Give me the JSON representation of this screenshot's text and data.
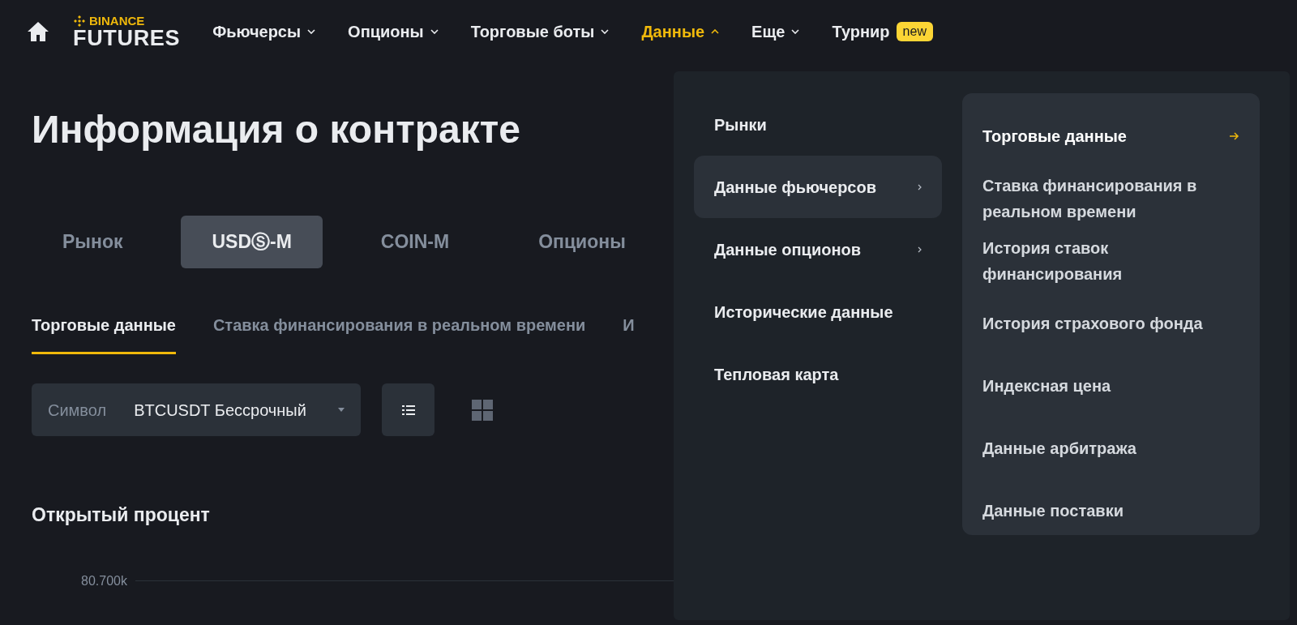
{
  "header": {
    "logo": {
      "top": "BINANCE",
      "bottom": "FUTURES"
    },
    "nav": [
      {
        "label": "Фьючерсы",
        "selected": false,
        "expanded": false
      },
      {
        "label": "Опционы",
        "selected": false,
        "expanded": false
      },
      {
        "label": "Торговые боты",
        "selected": false,
        "expanded": false
      },
      {
        "label": "Данные",
        "selected": true,
        "expanded": true
      },
      {
        "label": "Еще",
        "selected": false,
        "expanded": false
      },
      {
        "label": "Турнир",
        "selected": false,
        "badge": "new"
      }
    ]
  },
  "page": {
    "title": "Информация о контракте",
    "market_tabs": [
      {
        "label": "Рынок",
        "selected": false
      },
      {
        "label": "USDⓈ-M",
        "selected": true
      },
      {
        "label": "COIN-M",
        "selected": false
      },
      {
        "label": "Опционы",
        "selected": false
      }
    ],
    "data_tabs": [
      {
        "label": "Торговые данные",
        "selected": true
      },
      {
        "label": "Ставка финансирования в реальном времени",
        "selected": false
      },
      {
        "label": "И",
        "selected": false
      }
    ],
    "symbol": {
      "label": "Символ",
      "value": "BTCUSDT Бессрочный"
    },
    "views": [
      {
        "kind": "list",
        "selected": true
      },
      {
        "kind": "grid",
        "selected": false
      }
    ],
    "section_title": "Открытый процент",
    "axis_label": "80.700k"
  },
  "menu": {
    "left": [
      {
        "label": "Рынки",
        "selected": false,
        "submenu": false
      },
      {
        "label": "Данные фьючерсов",
        "selected": true,
        "submenu": true
      },
      {
        "label": "Данные опционов",
        "selected": false,
        "submenu": true
      },
      {
        "label": "Исторические данные",
        "selected": false,
        "submenu": false
      },
      {
        "label": "Тепловая карта",
        "selected": false,
        "submenu": false
      }
    ],
    "right": [
      {
        "label": "Торговые данные",
        "selected": true
      },
      {
        "label": "Ставка финансирования в реальном времени",
        "selected": false
      },
      {
        "label": "История ставок финансирования",
        "selected": false
      },
      {
        "label": "История страхового фонда",
        "selected": false
      },
      {
        "label": "Индексная цена",
        "selected": false
      },
      {
        "label": "Данные арбитража",
        "selected": false
      },
      {
        "label": "Данные поставки",
        "selected": false
      }
    ]
  }
}
